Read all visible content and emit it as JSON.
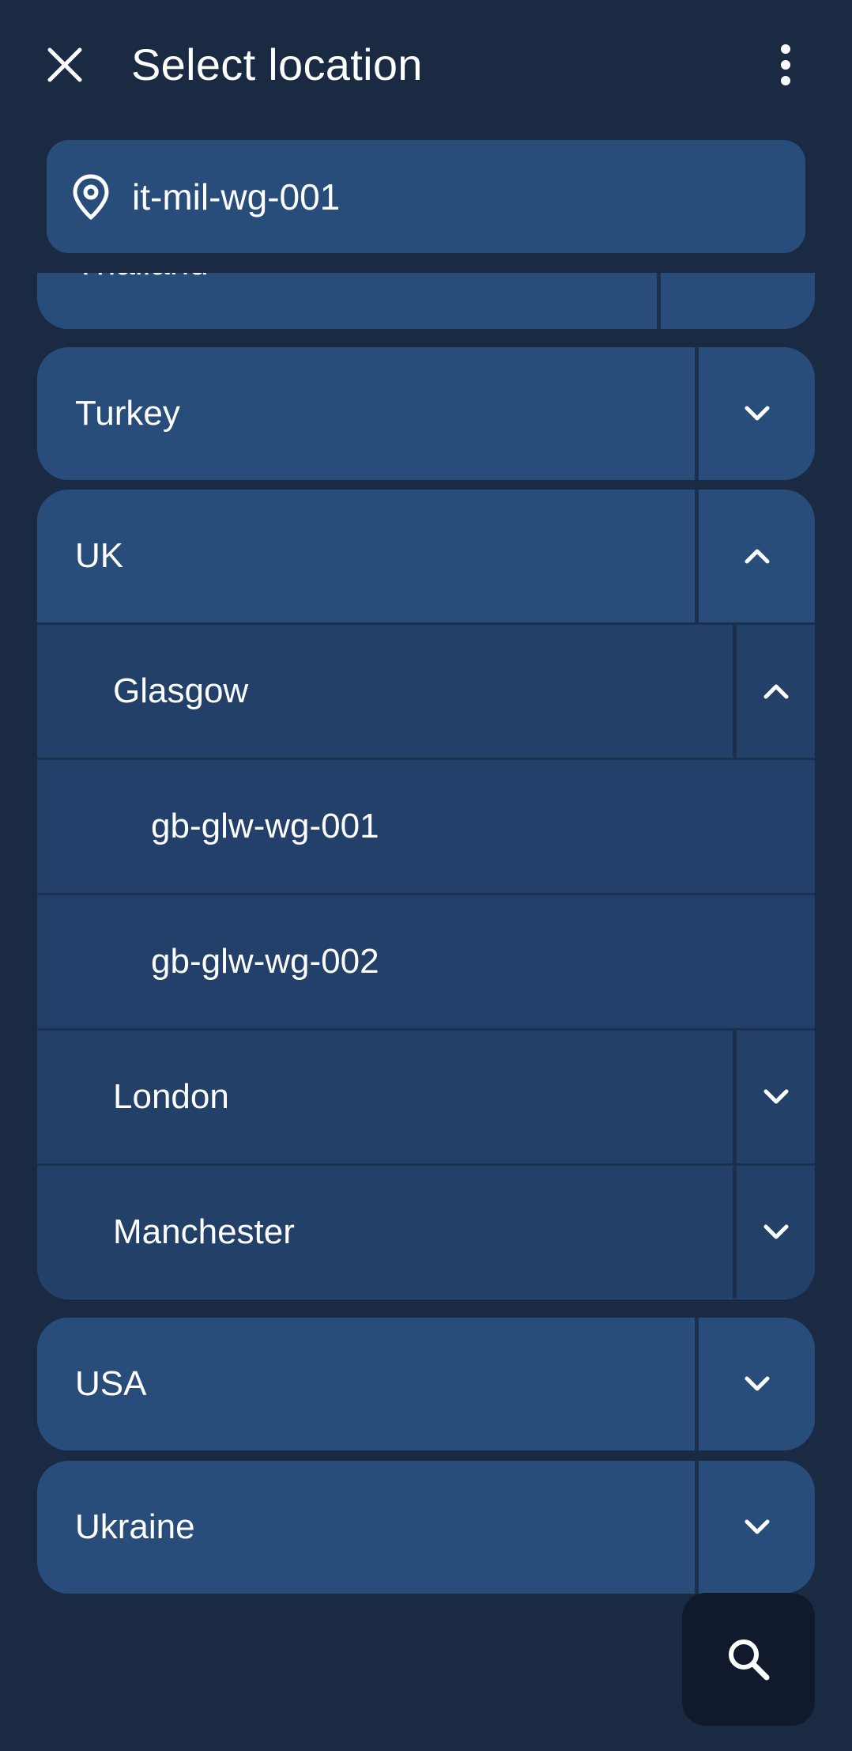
{
  "header": {
    "title": "Select location",
    "close_icon": "close-icon",
    "more_icon": "more-vertical-icon"
  },
  "current_location": {
    "icon": "location-pin-icon",
    "value": "it-mil-wg-001"
  },
  "locations": {
    "thailand": {
      "label": "Thailand",
      "expanded": false
    },
    "turkey": {
      "label": "Turkey",
      "expanded": false
    },
    "uk": {
      "label": "UK",
      "expanded": true,
      "cities": {
        "glasgow": {
          "label": "Glasgow",
          "expanded": true,
          "relays": [
            "gb-glw-wg-001",
            "gb-glw-wg-002"
          ]
        },
        "london": {
          "label": "London",
          "expanded": false
        },
        "manchester": {
          "label": "Manchester",
          "expanded": false
        }
      }
    },
    "usa": {
      "label": "USA",
      "expanded": false
    },
    "ukraine": {
      "label": "Ukraine",
      "expanded": false
    }
  },
  "fab": {
    "icon": "search-icon"
  },
  "colors": {
    "background": "#1b2a43",
    "country_row": "#294d7a",
    "city_row": "#224068",
    "divider": "#1c2f4c",
    "fab": "#101a2c"
  }
}
